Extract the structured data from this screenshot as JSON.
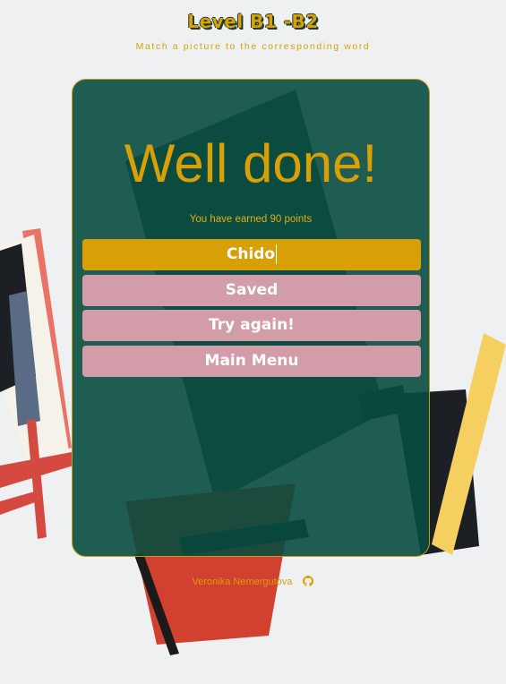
{
  "header": {
    "title": "Level B1 -B2",
    "subtitle": "Match a picture to the corresponding word"
  },
  "result": {
    "heading": "Well done!",
    "points_message": "You have earned 90 points"
  },
  "buttons": [
    {
      "label": "Chido",
      "style": "primary"
    },
    {
      "label": "Saved",
      "style": "secondary"
    },
    {
      "label": "Try again!",
      "style": "secondary"
    },
    {
      "label": "Main Menu",
      "style": "secondary"
    }
  ],
  "footer": {
    "author": "Veronika Nemergutova",
    "icon": "github-icon"
  },
  "colors": {
    "accent": "#d99f07",
    "card": "#0b4c40",
    "secondary_button": "#d29ca8"
  }
}
